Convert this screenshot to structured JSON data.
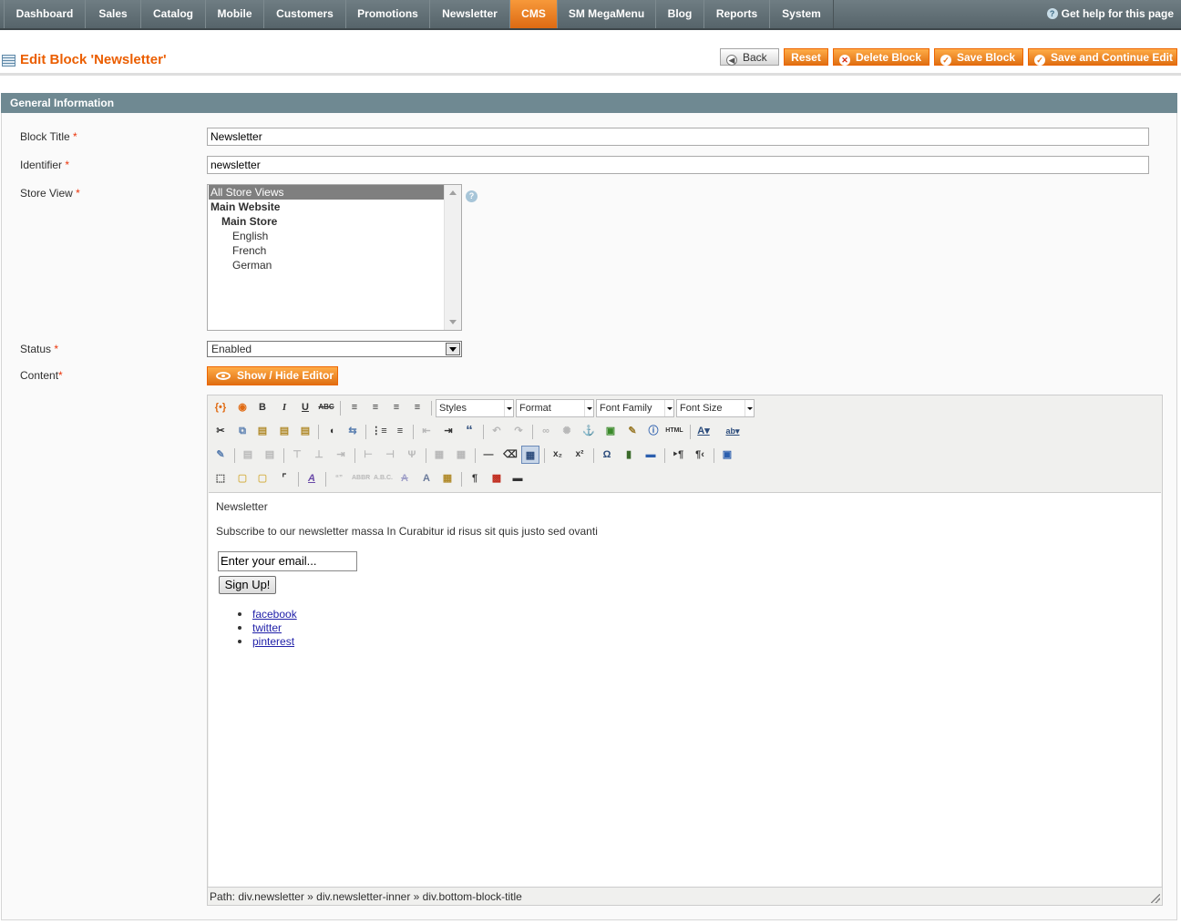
{
  "nav": {
    "items": [
      "Dashboard",
      "Sales",
      "Catalog",
      "Mobile",
      "Customers",
      "Promotions",
      "Newsletter",
      "CMS",
      "SM MegaMenu",
      "Blog",
      "Reports",
      "System"
    ],
    "active": "CMS",
    "help": "Get help for this page"
  },
  "header": {
    "title": "Edit Block 'Newsletter'",
    "buttons": {
      "back": "Back",
      "reset": "Reset",
      "delete": "Delete Block",
      "save": "Save Block",
      "save_continue": "Save and Continue Edit"
    }
  },
  "section": {
    "title": "General Information"
  },
  "form": {
    "block_title": {
      "label": "Block Title",
      "value": "Newsletter"
    },
    "identifier": {
      "label": "Identifier",
      "value": "newsletter"
    },
    "store_view": {
      "label": "Store View",
      "options": [
        "All Store Views",
        "Main Website",
        "Main Store",
        "English",
        "French",
        "German"
      ],
      "selected": "All Store Views"
    },
    "status": {
      "label": "Status",
      "value": "Enabled"
    },
    "content": {
      "label": "Content",
      "toggle_editor": "Show / Hide Editor"
    }
  },
  "editor": {
    "selects": {
      "styles": "Styles",
      "format": "Format",
      "font_family": "Font Family",
      "font_size": "Font Size"
    },
    "body": {
      "heading": "Newsletter",
      "paragraph": "Subscribe to our newsletter massa In Curabitur id risus sit quis justo sed ovanti",
      "email_placeholder": "Enter your email...",
      "signup": "Sign Up!",
      "links": [
        "facebook",
        "twitter",
        "pinterest"
      ]
    },
    "path": "Path: div.newsletter » div.newsletter-inner » div.bottom-block-title"
  },
  "required_mark": "*"
}
